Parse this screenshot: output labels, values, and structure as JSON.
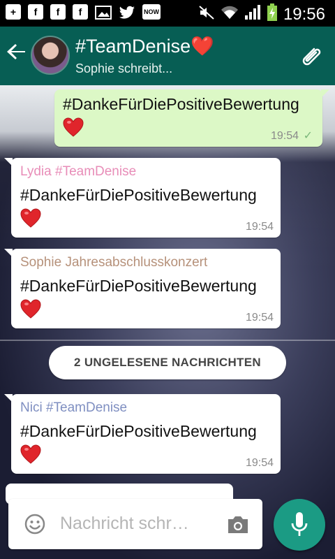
{
  "status_bar": {
    "time": "19:56",
    "now_badge": "NOW"
  },
  "header": {
    "back_icon": "arrow-left",
    "title": "#TeamDenise❤️",
    "subtitle": "Sophie schreibt..."
  },
  "messages": [
    {
      "type": "outgoing",
      "text": "#DankeFürDiePositiveBewertung",
      "time": "19:54",
      "status": "✓"
    },
    {
      "type": "incoming",
      "sender": "Lydia #TeamDenise",
      "sender_color": "#e88db8",
      "text": "#DankeFürDiePositiveBewertung",
      "time": "19:54"
    },
    {
      "type": "incoming",
      "sender": "Sophie Jahresabschlusskonzert",
      "sender_color": "#b6917a",
      "text": "#DankeFürDiePositiveBewertung",
      "time": "19:54"
    },
    {
      "type": "incoming",
      "sender": "Nici #TeamDenise",
      "sender_color": "#7f8fc1",
      "text": "#DankeFürDiePositiveBewertung",
      "time": "19:54"
    }
  ],
  "unread_label": "2 UNGELESENE NACHRICHTEN",
  "composer": {
    "placeholder": "Nachricht schr…"
  },
  "colors": {
    "appbar": "#075e54",
    "outgoing_bubble": "#dcf8c6",
    "mic_button": "#1b9b84"
  }
}
